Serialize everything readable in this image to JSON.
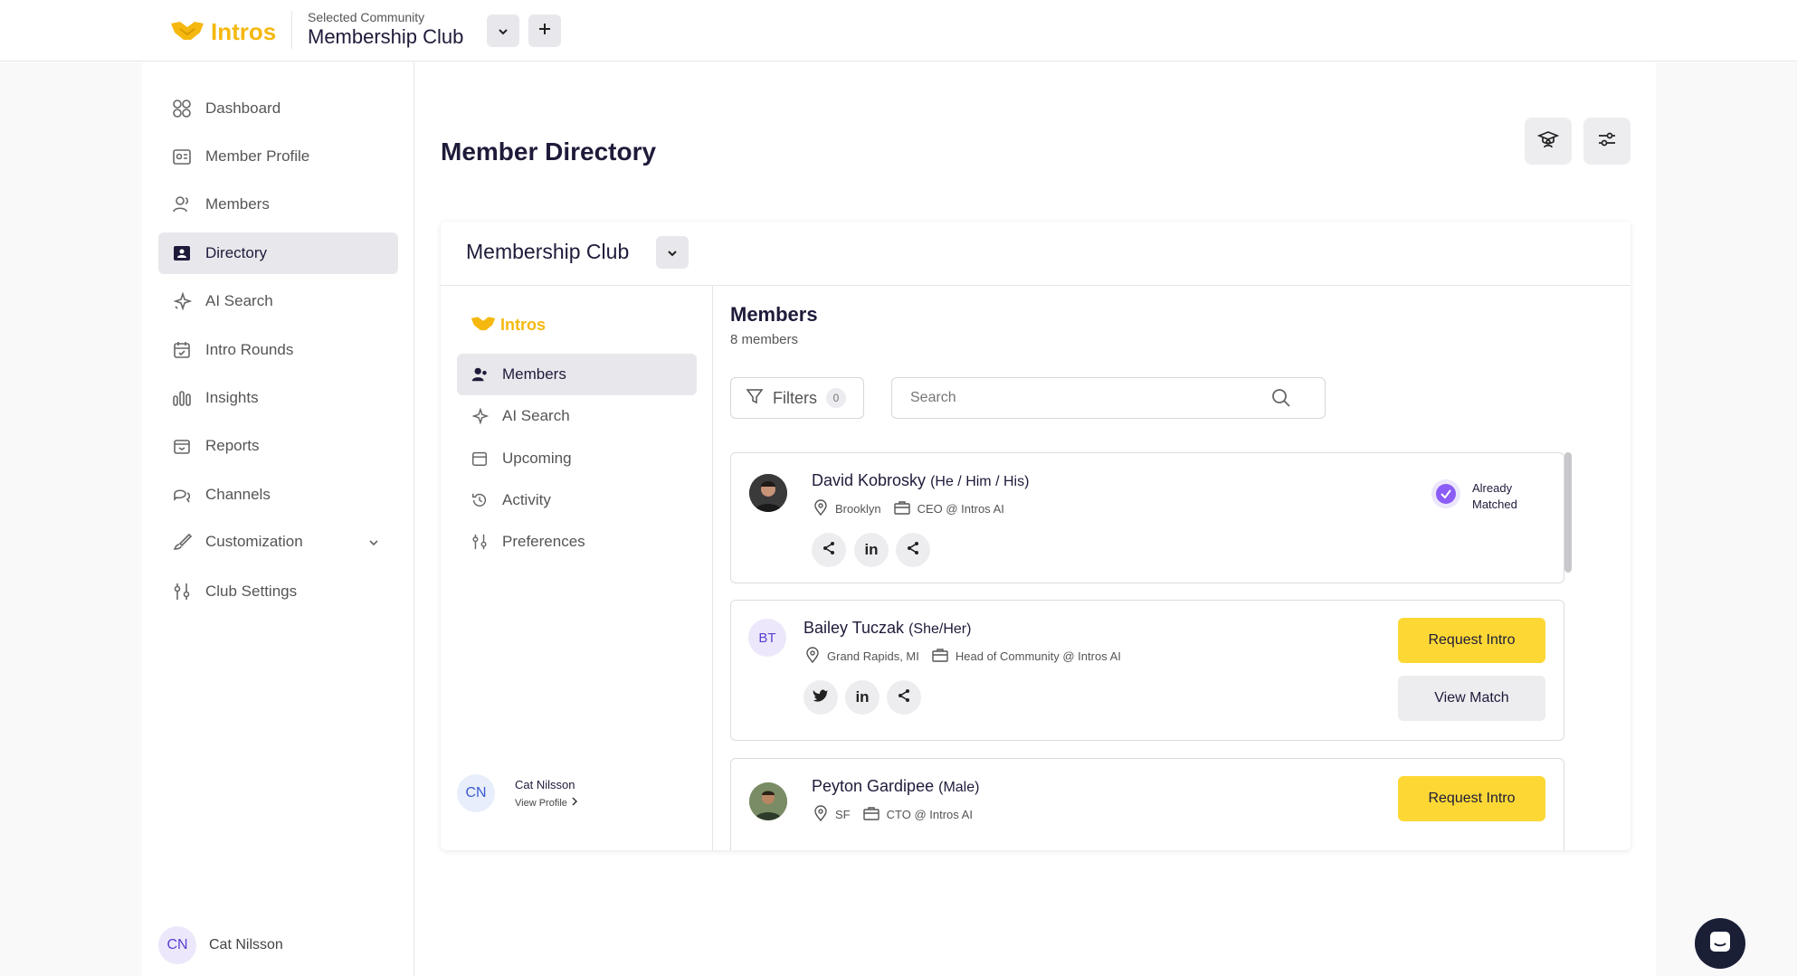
{
  "topbar": {
    "logo_text": "Intros",
    "community_label": "Selected Community",
    "community_name": "Membership Club"
  },
  "sidebar": {
    "items": [
      {
        "label": "Dashboard"
      },
      {
        "label": "Member Profile"
      },
      {
        "label": "Members"
      },
      {
        "label": "Directory"
      },
      {
        "label": "AI Search"
      },
      {
        "label": "Intro Rounds"
      },
      {
        "label": "Insights"
      },
      {
        "label": "Reports"
      },
      {
        "label": "Channels"
      },
      {
        "label": "Customization"
      },
      {
        "label": "Club Settings"
      }
    ],
    "user": {
      "initials": "CN",
      "name": "Cat Nilsson"
    }
  },
  "page": {
    "title": "Member Directory"
  },
  "card": {
    "title": "Membership Club",
    "logo_text": "Intros",
    "nav": [
      {
        "label": "Members"
      },
      {
        "label": "AI Search"
      },
      {
        "label": "Upcoming"
      },
      {
        "label": "Activity"
      },
      {
        "label": "Preferences"
      }
    ],
    "profile": {
      "initials": "CN",
      "name": "Cat Nilsson",
      "link": "View Profile"
    },
    "members_title": "Members",
    "members_count": "8 members",
    "filters_label": "Filters",
    "filters_count": "0",
    "search_placeholder": "Search"
  },
  "members": [
    {
      "name": "David Kobrosky",
      "pronouns": "(He / Him / His)",
      "location": "Brooklyn",
      "role": "CEO @ Intros AI",
      "status_line1": "Already",
      "status_line2": "Matched"
    },
    {
      "initials": "BT",
      "name": "Bailey Tuczak",
      "pronouns": "(She/Her)",
      "location": "Grand Rapids, MI",
      "role": "Head of Community @ Intros AI",
      "request_label": "Request Intro",
      "view_label": "View Match"
    },
    {
      "name": "Peyton Gardipee",
      "pronouns": "(Male)",
      "location": "SF",
      "role": "CTO @ Intros AI",
      "request_label": "Request Intro"
    }
  ],
  "colors": {
    "accent": "#fdd835",
    "brand": "#f5b80f",
    "matched": "#8b5cf6"
  }
}
